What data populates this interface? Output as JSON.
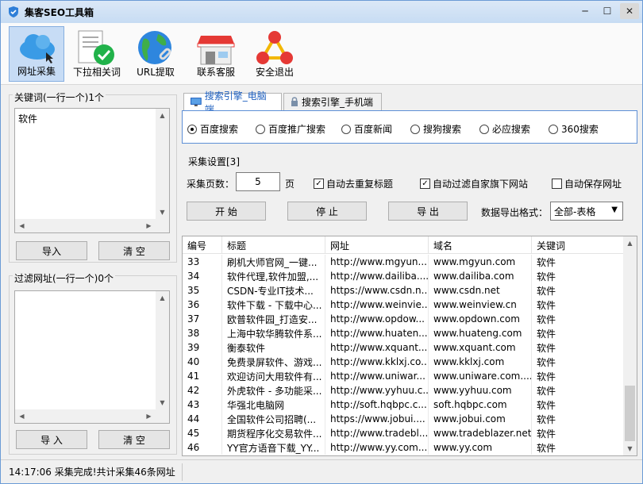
{
  "app": {
    "title": "集客SEO工具箱"
  },
  "window_controls": {
    "minimize": "─",
    "maximize": "☐",
    "close": "✕"
  },
  "toolbar": {
    "items": [
      {
        "label": "网址采集",
        "active": true
      },
      {
        "label": "下拉相关词",
        "active": false
      },
      {
        "label": "URL提取",
        "active": false
      },
      {
        "label": "联系客服",
        "active": false
      },
      {
        "label": "安全退出",
        "active": false
      }
    ]
  },
  "keywords": {
    "title": "关键词(一行一个)1个",
    "content": "软件",
    "import_label": "导入",
    "clear_label": "清 空"
  },
  "filter": {
    "title": "过滤网址(一行一个)0个",
    "content": "",
    "import_label": "导 入",
    "clear_label": "清 空"
  },
  "tabs": [
    {
      "label": "搜索引擎_电脑端",
      "active": true
    },
    {
      "label": "搜索引擎_手机端",
      "active": false
    }
  ],
  "engines": [
    {
      "label": "百度搜索",
      "selected": true
    },
    {
      "label": "百度推广搜索",
      "selected": false
    },
    {
      "label": "百度新闻",
      "selected": false
    },
    {
      "label": "搜狗搜索",
      "selected": false
    },
    {
      "label": "必应搜索",
      "selected": false
    },
    {
      "label": "360搜索",
      "selected": false
    }
  ],
  "settings": {
    "title": "采集设置[3]",
    "pages_label": "采集页数：",
    "pages_value": "5",
    "pages_unit": "页",
    "dedupe_title": {
      "label": "自动去重复标题",
      "checked": true
    },
    "filter_own": {
      "label": "自动过滤自家旗下网站",
      "checked": true
    },
    "auto_save": {
      "label": "自动保存网址",
      "checked": false
    },
    "start_label": "开 始",
    "stop_label": "停 止",
    "export_label": "导 出",
    "export_format_label": "数据导出格式：",
    "export_format_value": "全部-表格"
  },
  "table": {
    "columns": [
      "编号",
      "标题",
      "网址",
      "域名",
      "关键词"
    ],
    "rows": [
      [
        "33",
        "刷机大师官网_一键...",
        "http://www.mgyun....",
        "www.mgyun.com",
        "软件"
      ],
      [
        "34",
        "软件代理,软件加盟,...",
        "http://www.dailiba....",
        "www.dailiba.com",
        "软件"
      ],
      [
        "35",
        "CSDN-专业IT技术...",
        "https://www.csdn.n...",
        "www.csdn.net",
        "软件"
      ],
      [
        "36",
        "软件下载 - 下载中心...",
        "http://www.weinvie...",
        "www.weinview.cn",
        "软件"
      ],
      [
        "37",
        "欧普软件园_打造安...",
        "http://www.opdow...",
        "www.opdown.com",
        "软件"
      ],
      [
        "38",
        "上海中软华腾软件系...",
        "http://www.huaten...",
        "www.huateng.com",
        "软件"
      ],
      [
        "39",
        "衡泰软件",
        "http://www.xquant....",
        "www.xquant.com",
        "软件"
      ],
      [
        "40",
        "免费录屏软件、游戏...",
        "http://www.kklxj.co...",
        "www.kklxj.com",
        "软件"
      ],
      [
        "41",
        "欢迎访问大用软件有...",
        "http://www.uniwar...",
        "www.uniware.com....",
        "软件"
      ],
      [
        "42",
        "外虎软件 - 多功能采...",
        "http://www.yyhuu.c...",
        "www.yyhuu.com",
        "软件"
      ],
      [
        "43",
        "华强北电脑网",
        "http://soft.hqbpc.c...",
        "soft.hqbpc.com",
        "软件"
      ],
      [
        "44",
        "全国软件公司招聘(...",
        "https://www.jobui....",
        "www.jobui.com",
        "软件"
      ],
      [
        "45",
        "期货程序化交易软件...",
        "http://www.tradebl...",
        "www.tradeblazer.net",
        "软件"
      ],
      [
        "46",
        "YY官方语音下载_YY...",
        "http://www.yy.com...",
        "www.yy.com",
        "软件"
      ]
    ]
  },
  "status": {
    "text": "14:17:06 采集完成!共计采集46条网址"
  }
}
